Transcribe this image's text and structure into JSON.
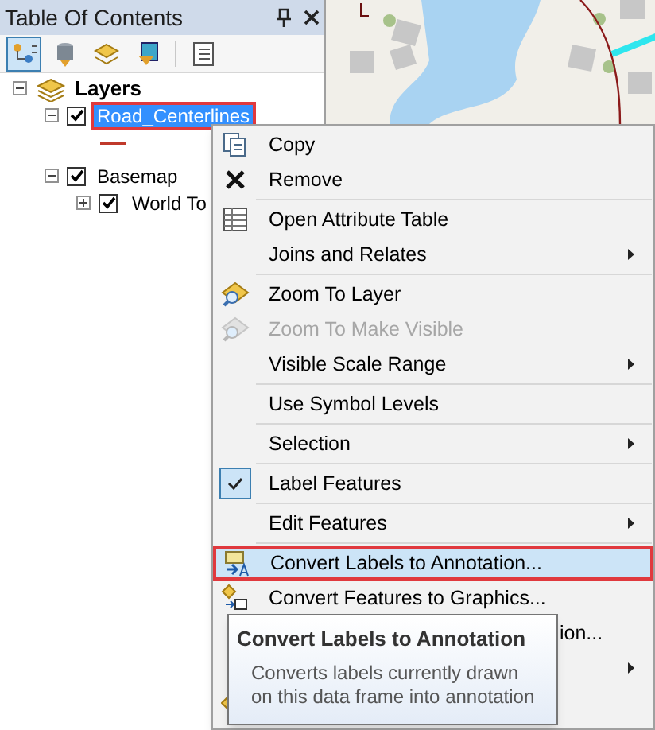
{
  "toc": {
    "title": "Table Of Contents",
    "toolbar": [
      {
        "selected": true
      },
      {
        "selected": false
      },
      {
        "selected": false
      },
      {
        "selected": false
      },
      {
        "selected": false
      }
    ],
    "tree": [
      {
        "label": "Layers",
        "kind": "frame",
        "expanded": true,
        "children": [
          {
            "label": "Road_Centerlines",
            "kind": "line",
            "expanded": true,
            "checked": true,
            "selected": true,
            "outlined": true
          },
          {
            "label": "Basemap",
            "kind": "group",
            "expanded": true,
            "checked": true,
            "selected": false,
            "outlined": false,
            "children": [
              {
                "label": "World To",
                "kind": "tiled",
                "expanded": false,
                "checked": true,
                "selected": false,
                "outlined": false
              }
            ]
          }
        ]
      }
    ]
  },
  "context_menu": {
    "groups": [
      [
        {
          "label": "Copy",
          "disabled": false,
          "submenu": false,
          "selected": false
        },
        {
          "label": "Remove",
          "disabled": false,
          "submenu": false,
          "selected": false
        }
      ],
      [
        {
          "label": "Open Attribute Table",
          "disabled": false,
          "submenu": false,
          "selected": false
        },
        {
          "label": "Joins and Relates",
          "disabled": false,
          "submenu": true,
          "selected": false
        }
      ],
      [
        {
          "label": "Zoom To Layer",
          "disabled": false,
          "submenu": false,
          "selected": false
        },
        {
          "label": "Zoom To Make Visible",
          "disabled": true,
          "submenu": false,
          "selected": false
        },
        {
          "label": "Visible Scale Range",
          "disabled": false,
          "submenu": true,
          "selected": false
        }
      ],
      [
        {
          "label": "Use Symbol Levels",
          "disabled": false,
          "submenu": false,
          "selected": false
        }
      ],
      [
        {
          "label": "Selection",
          "disabled": false,
          "submenu": true,
          "selected": false
        }
      ],
      [
        {
          "label": "Label Features",
          "checked": true,
          "disabled": false,
          "submenu": false,
          "selected": false
        }
      ],
      [
        {
          "label": "Edit Features",
          "disabled": false,
          "submenu": true,
          "selected": false
        }
      ],
      [
        {
          "label": "Convert Labels to Annotation...",
          "disabled": false,
          "submenu": false,
          "selected": true,
          "outlined": true
        },
        {
          "label": "Convert Features to Graphics...",
          "disabled": false,
          "submenu": false,
          "selected": false
        },
        {
          "label": "ion...",
          "kind": "covered",
          "disabled": false,
          "submenu": false,
          "selected": false
        },
        {
          "submenu": true,
          "selected": false
        },
        {
          "submenu": false,
          "selected": false
        }
      ]
    ]
  },
  "tooltip": {
    "title": "Convert Labels to Annotation",
    "text": "Converts labels currently drawn on this data frame into annotation"
  }
}
